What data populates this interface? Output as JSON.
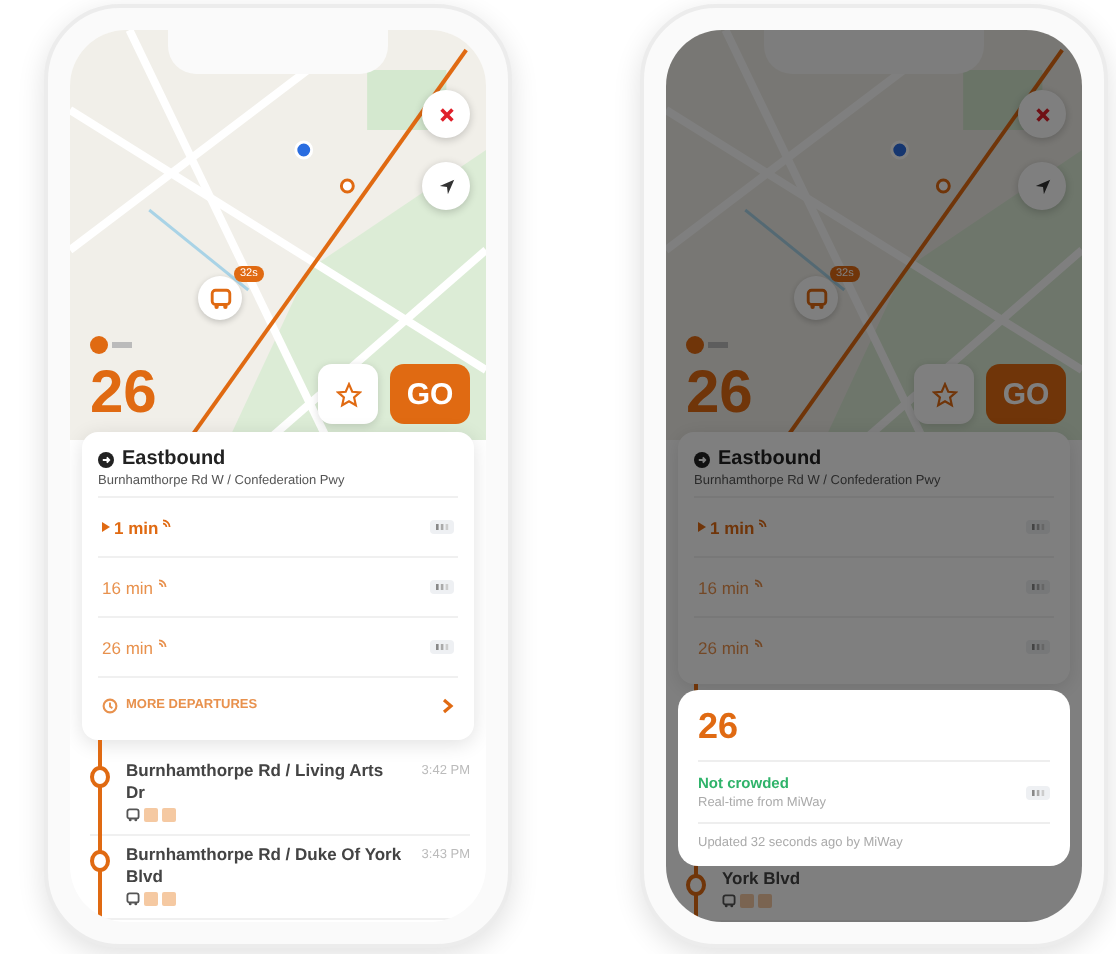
{
  "screens": [
    {
      "kind": "main",
      "map": {
        "vehicle_badge": "32s"
      },
      "route": "26",
      "go_button": "GO",
      "direction": "Eastbound",
      "stop": "Burnhamthorpe Rd W / Confederation Pwy",
      "departures": [
        {
          "time": "1 min",
          "selected": true
        },
        {
          "time": "16 min",
          "selected": false
        },
        {
          "time": "26 min",
          "selected": false
        }
      ],
      "more_departures": "MORE DEPARTURES",
      "stops": [
        {
          "name": "Burnhamthorpe Rd / Living Arts Dr",
          "time": "3:42 PM"
        },
        {
          "name": "Burnhamthorpe Rd / Duke Of York Blvd",
          "time": "3:43 PM"
        }
      ]
    },
    {
      "kind": "detail",
      "map": {
        "vehicle_badge": "32s"
      },
      "route": "26",
      "go_button": "GO",
      "direction": "Eastbound",
      "stop": "Burnhamthorpe Rd W / Confederation Pwy",
      "departures": [
        {
          "time": "1 min",
          "selected": true
        },
        {
          "time": "16 min",
          "selected": false
        },
        {
          "time": "26 min",
          "selected": false
        }
      ],
      "stops": [
        {
          "name": "York Blvd"
        }
      ],
      "popup": {
        "route": "26",
        "crowding": "Not crowded",
        "source": "Real-time from MiWay",
        "updated": "Updated 32 seconds ago by MiWay"
      }
    }
  ]
}
